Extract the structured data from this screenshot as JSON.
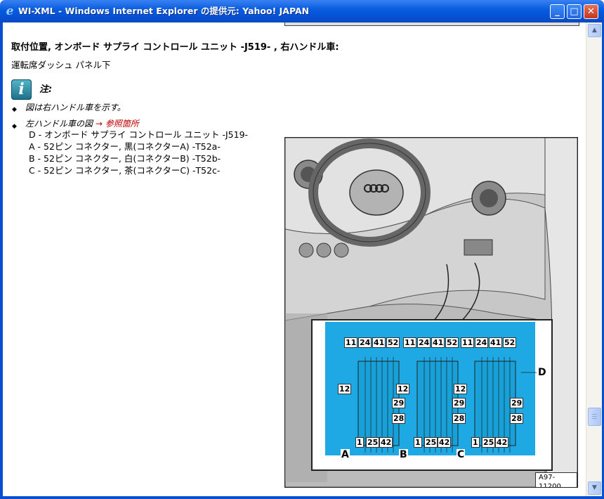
{
  "window": {
    "title": "WI-XML - Windows Internet Explorer の提供元: Yahoo! JAPAN",
    "icon": "ie-icon"
  },
  "page": {
    "heading": "取付位置, オンボード サプライ コントロール ユニット -J519- , 右ハンドル車:",
    "subtext": "運転席ダッシュ パネル下",
    "note_label": "注:",
    "bullets": [
      {
        "text": "図は右ハンドル車を示す。"
      },
      {
        "text": "左ハンドル車の図",
        "ref": "→ 参照箇所"
      }
    ],
    "legend": [
      "D - オンボード サプライ コントロール ユニット -J519-",
      "A - 52ピン コネクター, 黒(コネクターA) -T52a-",
      "B - 52ピン コネクター, 白(コネクターB) -T52b-",
      "C - 52ピン コネクター, 茶(コネクターC) -T52c-"
    ]
  },
  "figure": {
    "connector_pins_top": [
      "11",
      "24",
      "41",
      "52"
    ],
    "connector_pin_left": "12",
    "connector_pins_right": [
      "29",
      "28"
    ],
    "connector_pins_bottom": [
      "1",
      "25",
      "42"
    ],
    "connectors": [
      "A",
      "B",
      "C"
    ],
    "unit_label": "D",
    "figure_id": "A97-11200",
    "accent_color": "#1fa9e4"
  }
}
